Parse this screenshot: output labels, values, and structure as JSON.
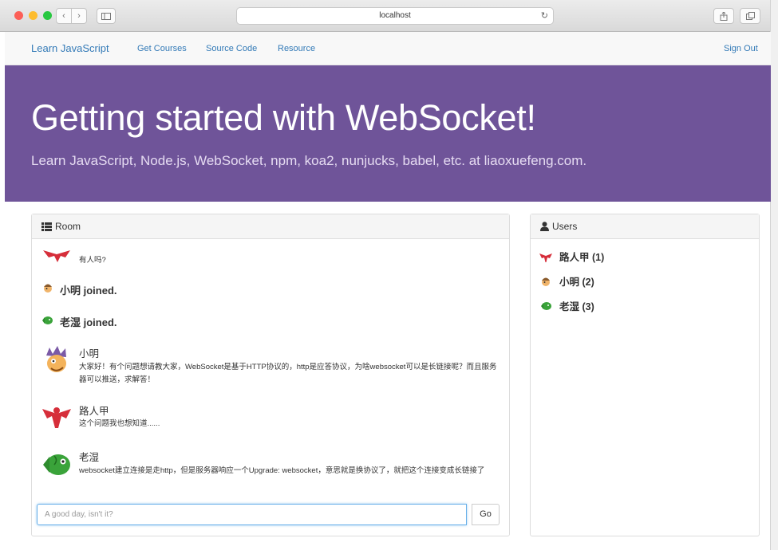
{
  "browser": {
    "address": "localhost"
  },
  "nav": {
    "brand": "Learn JavaScript",
    "links": [
      "Get Courses",
      "Source Code",
      "Resource"
    ],
    "signout": "Sign Out"
  },
  "jumbotron": {
    "title": "Getting started with WebSocket!",
    "subtitle": "Learn JavaScript, Node.js, WebSocket, npm, koa2, nunjucks, babel, etc. at liaoxuefeng.com."
  },
  "room": {
    "header": "Room",
    "messages": [
      {
        "type": "text",
        "avatar": "red-bird-avatar-icon",
        "text": "有人吗?"
      },
      {
        "type": "join",
        "avatar": "cartoon-face-avatar-icon",
        "text": "小明 joined."
      },
      {
        "type": "join",
        "avatar": "green-fish-avatar-icon",
        "text": "老湿 joined."
      },
      {
        "type": "chat",
        "avatar": "purple-monster-avatar-icon",
        "name": "小明",
        "text": "大家好！有个问题想请教大家，WebSocket是基于HTTP协议的，http是应答协议，为啥websocket可以是长链接呢？而且服务器可以推送，求解答！"
      },
      {
        "type": "chat",
        "avatar": "red-bird-avatar-icon",
        "name": "路人甲",
        "text": "这个问题我也想知道......"
      },
      {
        "type": "chat",
        "avatar": "green-fish-avatar-icon",
        "name": "老湿",
        "text": "websocket建立连接是走http，但是服务器响应一个Upgrade: websocket，意思就是换协议了，就把这个连接变成长链接了"
      }
    ],
    "input_placeholder": "A good day, isn't it?",
    "send_label": "Go"
  },
  "users": {
    "header": "Users",
    "list": [
      {
        "label": "路人甲 (1)",
        "icon": "red-bird-avatar-icon"
      },
      {
        "label": "小明 (2)",
        "icon": "cartoon-face-avatar-icon"
      },
      {
        "label": "老湿 (3)",
        "icon": "green-fish-avatar-icon"
      }
    ]
  },
  "colors": {
    "jumbotron": "#6f5499",
    "link": "#337ab7"
  }
}
